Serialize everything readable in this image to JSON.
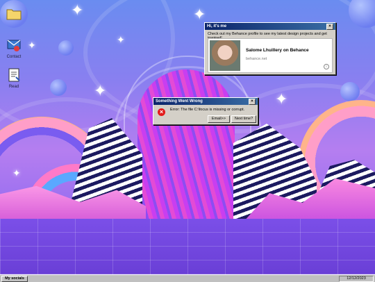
{
  "desktop_icons": [
    {
      "name": "folder-icon",
      "label": ""
    },
    {
      "name": "contact-icon",
      "label": "Contact"
    },
    {
      "name": "read-icon",
      "label": "Read"
    }
  ],
  "popup": {
    "title": "Hi, it's me",
    "close": "×",
    "message": "Check out my Behance profile to see my latest design projects and get inspired!",
    "card_title": "Salome Lhuillery on Behance",
    "card_url": "behance.net",
    "info_icon": "i"
  },
  "error_dialog": {
    "title": "Something Went Wrong",
    "close": "×",
    "message": "Error: The file C:\\focus is missing or corrupt.",
    "error_icon": "×",
    "buttons": [
      "Email>>",
      "Next time?"
    ]
  },
  "taskbar": {
    "start_label": "My socials",
    "date": "12/12/2023"
  },
  "colors": {
    "titlebar_start": "#0a246a",
    "titlebar_end": "#3a6ea5",
    "error_red": "#e21b1b"
  }
}
